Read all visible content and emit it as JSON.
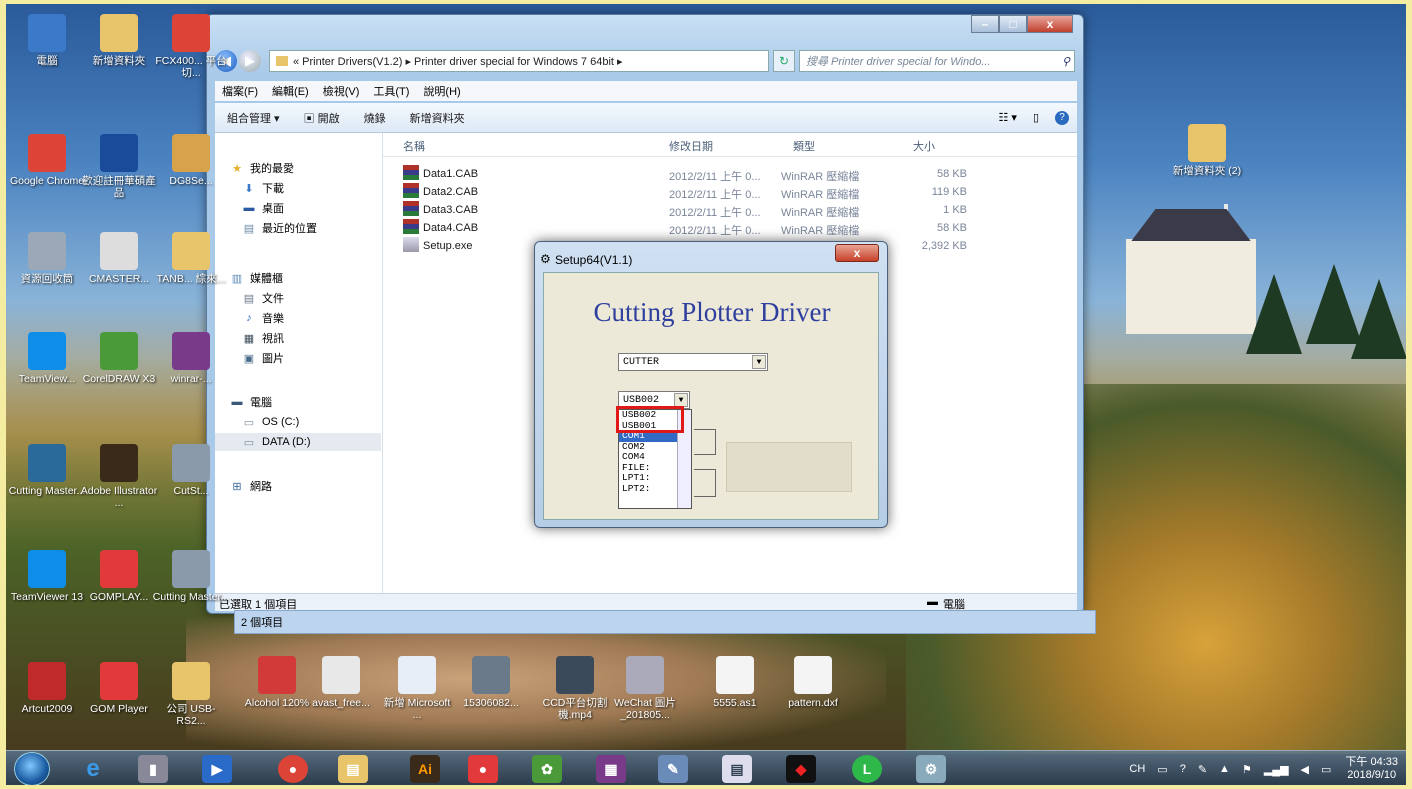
{
  "desktop": {
    "icons_col1": [
      {
        "label": "電腦",
        "icon": "computer-icon",
        "color": "#3a7ac8"
      },
      {
        "label": "Google Chrome",
        "icon": "chrome-icon",
        "color": "#db4437"
      },
      {
        "label": "資源回收筒",
        "icon": "recycle-bin-icon",
        "color": "#9aa8b8"
      },
      {
        "label": "TeamView...",
        "icon": "teamviewer-icon",
        "color": "#0e8ee9"
      },
      {
        "label": "Cutting Master...",
        "icon": "cutting-master-icon",
        "color": "#2a6a9a"
      },
      {
        "label": "TeamViewer 13",
        "icon": "teamviewer-icon",
        "color": "#0e8ee9"
      },
      {
        "label": "Artcut2009",
        "icon": "artcut-icon",
        "color": "#c02a2a"
      }
    ],
    "icons_col2": [
      {
        "label": "新增資料夾",
        "icon": "folder-icon",
        "color": "#e8c56a"
      },
      {
        "label": "歡迎註冊華碩產品",
        "icon": "asus-icon",
        "color": "#1a4a9a"
      },
      {
        "label": "CMASTER...",
        "icon": "cmaster-icon",
        "color": "#ddd"
      },
      {
        "label": "CorelDRAW X3",
        "icon": "coreldraw-icon",
        "color": "#4a9a3a"
      },
      {
        "label": "Adobe Illustrator ...",
        "icon": "illustrator-icon",
        "color": "#3a2a1a"
      },
      {
        "label": "GOMPLAY...",
        "icon": "gomplay-icon",
        "color": "#e23a3a"
      },
      {
        "label": "GOM Player",
        "icon": "gom-player-icon",
        "color": "#e23a3a"
      }
    ],
    "icons_col3": [
      {
        "label": "FCX400... 平台切...",
        "icon": "chrome-icon",
        "color": "#db4437"
      },
      {
        "label": "DG8Se...",
        "icon": "package-icon",
        "color": "#d8a24a"
      },
      {
        "label": "TANB... 綜來...",
        "icon": "folder-icon",
        "color": "#e8c56a"
      },
      {
        "label": "winrar-...",
        "icon": "winrar-icon",
        "color": "#7a3a8a"
      },
      {
        "label": "CutSt...",
        "icon": "cutstudio-icon",
        "color": "#8a9aaa"
      },
      {
        "label": "Cutting Master...",
        "icon": "cutting-master-icon",
        "color": "#8a9aaa"
      },
      {
        "label": "公司 USB-RS2...",
        "icon": "folder-icon",
        "color": "#e8c56a"
      }
    ],
    "icons_bottom": [
      {
        "label": "Alcohol 120%",
        "icon": "alcohol-icon",
        "color": "#d23a3a"
      },
      {
        "label": "avast_free...",
        "icon": "avast-icon",
        "color": "#e8e8e8"
      },
      {
        "label": "新增 Microsoft ...",
        "icon": "word-doc-icon",
        "color": "#e8eef8"
      },
      {
        "label": "15306082...",
        "icon": "image-file-icon",
        "color": "#6a7a8a"
      },
      {
        "label": "CCD平台切割機.mp4",
        "icon": "video-file-icon",
        "color": "#3a4a5a"
      },
      {
        "label": "WeChat 圖片_201805...",
        "icon": "image-file-icon",
        "color": "#aab"
      },
      {
        "label": "5555.as1",
        "icon": "blank-file-icon",
        "color": "#f4f4f4"
      },
      {
        "label": "pattern.dxf",
        "icon": "dxf-file-icon",
        "color": "#f4f4f4"
      }
    ],
    "right_folder": {
      "label": "新增資料夾 (2)",
      "icon": "folder-icon",
      "color": "#e8c56a"
    }
  },
  "explorer": {
    "breadcrumb": "« Printer Drivers(V1.2) ▸ Printer driver special for Windows 7 64bit ▸",
    "search_placeholder": "搜尋 Printer driver special for Windo...",
    "menu": [
      "檔案(F)",
      "編輯(E)",
      "檢視(V)",
      "工具(T)",
      "說明(H)"
    ],
    "commands": [
      "組合管理 ▾",
      "開啟",
      "燒錄",
      "新增資料夾"
    ],
    "nav": {
      "favorites": "我的最愛",
      "downloads": "下載",
      "desktop": "桌面",
      "recent": "最近的位置",
      "libraries": "媒體櫃",
      "documents": "文件",
      "music": "音樂",
      "videos": "視訊",
      "pictures": "圖片",
      "computer": "電腦",
      "os_drive": "OS (C:)",
      "data_drive": "DATA (D:)",
      "network": "網路"
    },
    "columns": {
      "name": "名稱",
      "date": "修改日期",
      "type": "類型",
      "size": "大小"
    },
    "files": [
      {
        "name": "Data1.CAB",
        "date": "2012/2/11 上午 0...",
        "type": "WinRAR 壓縮檔",
        "size": "58 KB"
      },
      {
        "name": "Data2.CAB",
        "date": "2012/2/11 上午 0...",
        "type": "WinRAR 壓縮檔",
        "size": "119 KB"
      },
      {
        "name": "Data3.CAB",
        "date": "2012/2/11 上午 0...",
        "type": "WinRAR 壓縮檔",
        "size": "1 KB"
      },
      {
        "name": "Data4.CAB",
        "date": "2012/2/11 上午 0...",
        "type": "WinRAR 壓縮檔",
        "size": "58 KB"
      },
      {
        "name": "Setup.exe",
        "date": "",
        "type": "",
        "size": "2,392 KB"
      }
    ],
    "status_selected": "已選取 1 個項目",
    "status_location": "電腦",
    "status_items": "2 個項目"
  },
  "setup_dialog": {
    "title": "Setup64(V1.1)",
    "heading": "Cutting Plotter Driver",
    "model_value": "CUTTER",
    "port_value": "USB002",
    "port_options": [
      "USB002",
      "USB001",
      "COM1",
      "COM2",
      "COM4",
      "FILE:",
      "LPT1:",
      "LPT2:"
    ],
    "highlighted_option": "COM1",
    "close_label": "x"
  },
  "taskbar": {
    "tray_lang": "CH",
    "clock_time": "下午 04:33",
    "clock_date": "2018/9/10"
  }
}
